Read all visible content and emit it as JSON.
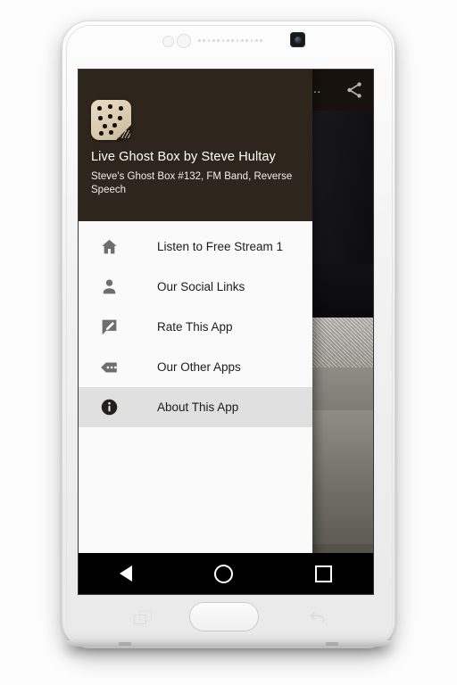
{
  "device": {
    "name": "android-phone",
    "hardware_keys": [
      {
        "name": "recents-key",
        "label": "Recents"
      },
      {
        "name": "home-key",
        "label": "Home"
      },
      {
        "name": "back-key",
        "label": "Back"
      }
    ]
  },
  "background_app": {
    "toolbar_title": "e...",
    "share_icon": "share-icon"
  },
  "drawer": {
    "header": {
      "app_icon": "ghost-box-app-icon",
      "title": "Live Ghost Box by Steve Hultay",
      "subtitle": "Steve's Ghost Box #132, FM Band, Reverse Speech",
      "background_color": "#2e261d"
    },
    "items": [
      {
        "icon": "home-icon",
        "label": "Listen to Free Stream 1",
        "selected": false
      },
      {
        "icon": "person-icon",
        "label": "Our Social Links",
        "selected": false
      },
      {
        "icon": "rate-comment-icon",
        "label": "Rate This App",
        "selected": false
      },
      {
        "icon": "more-apps-tag-icon",
        "label": "Our Other Apps",
        "selected": false
      },
      {
        "icon": "info-icon",
        "label": "About This App",
        "selected": true
      }
    ],
    "selected_background_color": "#e0e0e0"
  },
  "nav_bar": {
    "back": "back-triangle-icon",
    "home": "home-circle-icon",
    "recents": "recents-square-icon",
    "background_color": "#000000"
  }
}
